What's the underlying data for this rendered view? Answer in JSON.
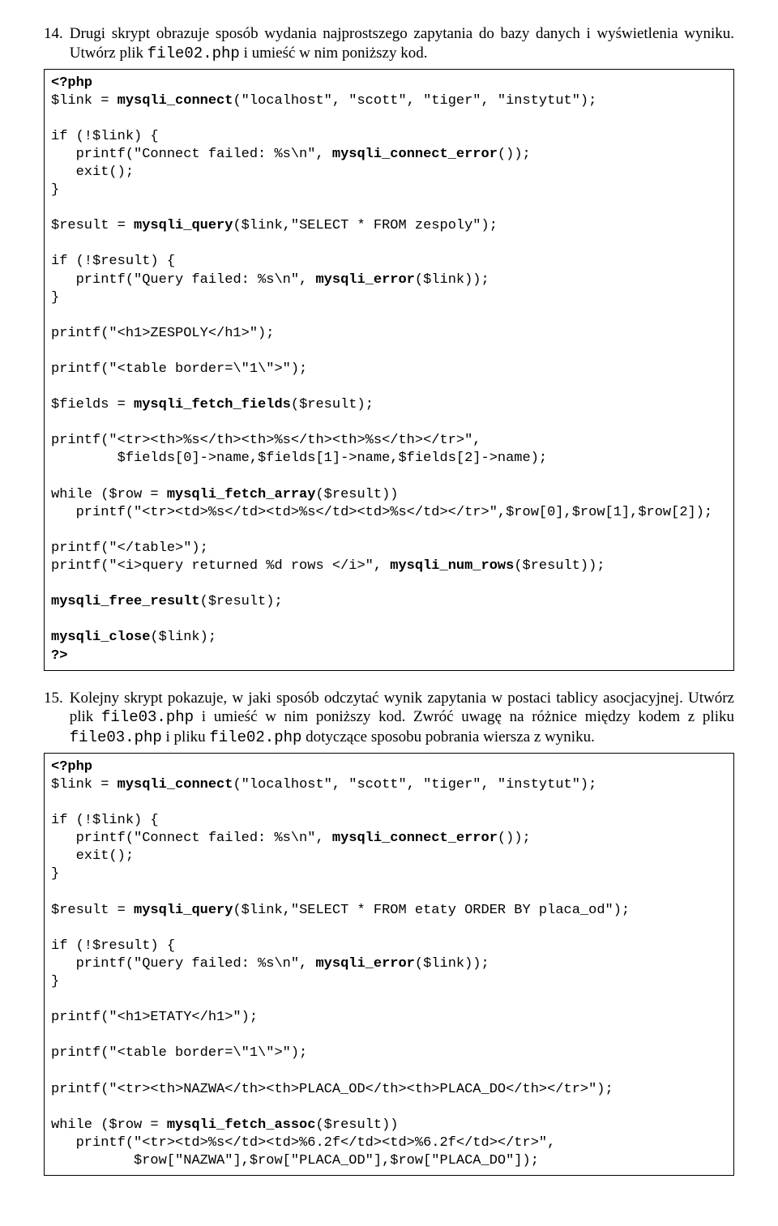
{
  "items": [
    {
      "num": "14.",
      "text_parts": [
        {
          "t": "Drugi skrypt obrazuje sposób wydania najprostszego zapytania do bazy danych i wyświetlenia wyniku. Utwórz plik "
        },
        {
          "t": "file02.php",
          "mono": true
        },
        {
          "t": " i umieść w nim poniższy kod."
        }
      ],
      "code": [
        {
          "segs": [
            {
              "t": "<?php",
              "b": true
            }
          ]
        },
        {
          "segs": [
            {
              "t": "$link = "
            },
            {
              "t": "mysqli_connect",
              "b": true
            },
            {
              "t": "(\"localhost\", \"scott\", \"tiger\", \"instytut\");"
            }
          ]
        },
        {
          "segs": [
            {
              "t": ""
            }
          ]
        },
        {
          "segs": [
            {
              "t": "if (!$link) {"
            }
          ]
        },
        {
          "segs": [
            {
              "t": "   printf(\"Connect failed: %s\\n\", "
            },
            {
              "t": "mysqli_connect_error",
              "b": true
            },
            {
              "t": "());"
            }
          ]
        },
        {
          "segs": [
            {
              "t": "   exit();"
            }
          ]
        },
        {
          "segs": [
            {
              "t": "}"
            }
          ]
        },
        {
          "segs": [
            {
              "t": ""
            }
          ]
        },
        {
          "segs": [
            {
              "t": "$result = "
            },
            {
              "t": "mysqli_query",
              "b": true
            },
            {
              "t": "($link,\"SELECT * FROM zespoly\");"
            }
          ]
        },
        {
          "segs": [
            {
              "t": ""
            }
          ]
        },
        {
          "segs": [
            {
              "t": "if (!$result) {"
            }
          ]
        },
        {
          "segs": [
            {
              "t": "   printf(\"Query failed: %s\\n\", "
            },
            {
              "t": "mysqli_error",
              "b": true
            },
            {
              "t": "($link));"
            }
          ]
        },
        {
          "segs": [
            {
              "t": "}"
            }
          ]
        },
        {
          "segs": [
            {
              "t": ""
            }
          ]
        },
        {
          "segs": [
            {
              "t": "printf(\"<h1>ZESPOLY</h1>\");"
            }
          ]
        },
        {
          "segs": [
            {
              "t": ""
            }
          ]
        },
        {
          "segs": [
            {
              "t": "printf(\"<table border=\\\"1\\\">\");"
            }
          ]
        },
        {
          "segs": [
            {
              "t": ""
            }
          ]
        },
        {
          "segs": [
            {
              "t": "$fields = "
            },
            {
              "t": "mysqli_fetch_fields",
              "b": true
            },
            {
              "t": "($result);"
            }
          ]
        },
        {
          "segs": [
            {
              "t": ""
            }
          ]
        },
        {
          "segs": [
            {
              "t": "printf(\"<tr><th>%s</th><th>%s</th><th>%s</th></tr>\","
            }
          ]
        },
        {
          "segs": [
            {
              "t": "        $fields[0]->name,$fields[1]->name,$fields[2]->name);"
            }
          ]
        },
        {
          "segs": [
            {
              "t": ""
            }
          ]
        },
        {
          "segs": [
            {
              "t": "while ($row = "
            },
            {
              "t": "mysqli_fetch_array",
              "b": true
            },
            {
              "t": "($result))"
            }
          ]
        },
        {
          "segs": [
            {
              "t": "   printf(\"<tr><td>%s</td><td>%s</td><td>%s</td></tr>\",$row[0],$row[1],$row[2]);"
            }
          ]
        },
        {
          "segs": [
            {
              "t": ""
            }
          ]
        },
        {
          "segs": [
            {
              "t": "printf(\"</table>\");"
            }
          ]
        },
        {
          "segs": [
            {
              "t": "printf(\"<i>query returned %d rows </i>\", "
            },
            {
              "t": "mysqli_num_rows",
              "b": true
            },
            {
              "t": "($result));"
            }
          ]
        },
        {
          "segs": [
            {
              "t": ""
            }
          ]
        },
        {
          "segs": [
            {
              "t": "mysqli_free_result",
              "b": true
            },
            {
              "t": "($result);"
            }
          ]
        },
        {
          "segs": [
            {
              "t": ""
            }
          ]
        },
        {
          "segs": [
            {
              "t": "mysqli_close",
              "b": true
            },
            {
              "t": "($link);"
            }
          ]
        },
        {
          "segs": [
            {
              "t": "?>",
              "b": true
            }
          ]
        }
      ]
    },
    {
      "num": "15.",
      "text_parts": [
        {
          "t": "Kolejny skrypt pokazuje, w jaki sposób odczytać wynik zapytania w postaci tablicy asocjacyjnej. Utwórz plik "
        },
        {
          "t": "file03.php",
          "mono": true
        },
        {
          "t": " i umieść w nim poniższy kod. Zwróć uwagę na różnice między kodem z pliku "
        },
        {
          "t": "file03.php",
          "mono": true
        },
        {
          "t": " i pliku "
        },
        {
          "t": "file02.php",
          "mono": true
        },
        {
          "t": " dotyczące sposobu pobrania wiersza z wyniku."
        }
      ],
      "code": [
        {
          "segs": [
            {
              "t": "<?php",
              "b": true
            }
          ]
        },
        {
          "segs": [
            {
              "t": "$link = "
            },
            {
              "t": "mysqli_connect",
              "b": true
            },
            {
              "t": "(\"localhost\", \"scott\", \"tiger\", \"instytut\");"
            }
          ]
        },
        {
          "segs": [
            {
              "t": ""
            }
          ]
        },
        {
          "segs": [
            {
              "t": "if (!$link) {"
            }
          ]
        },
        {
          "segs": [
            {
              "t": "   printf(\"Connect failed: %s\\n\", "
            },
            {
              "t": "mysqli_connect_error",
              "b": true
            },
            {
              "t": "());"
            }
          ]
        },
        {
          "segs": [
            {
              "t": "   exit();"
            }
          ]
        },
        {
          "segs": [
            {
              "t": "}"
            }
          ]
        },
        {
          "segs": [
            {
              "t": ""
            }
          ]
        },
        {
          "segs": [
            {
              "t": "$result = "
            },
            {
              "t": "mysqli_query",
              "b": true
            },
            {
              "t": "($link,\"SELECT * FROM etaty ORDER BY placa_od\");"
            }
          ]
        },
        {
          "segs": [
            {
              "t": ""
            }
          ]
        },
        {
          "segs": [
            {
              "t": "if (!$result) {"
            }
          ]
        },
        {
          "segs": [
            {
              "t": "   printf(\"Query failed: %s\\n\", "
            },
            {
              "t": "mysqli_error",
              "b": true
            },
            {
              "t": "($link));"
            }
          ]
        },
        {
          "segs": [
            {
              "t": "}"
            }
          ]
        },
        {
          "segs": [
            {
              "t": ""
            }
          ]
        },
        {
          "segs": [
            {
              "t": "printf(\"<h1>ETATY</h1>\");"
            }
          ]
        },
        {
          "segs": [
            {
              "t": ""
            }
          ]
        },
        {
          "segs": [
            {
              "t": "printf(\"<table border=\\\"1\\\">\");"
            }
          ]
        },
        {
          "segs": [
            {
              "t": ""
            }
          ]
        },
        {
          "segs": [
            {
              "t": "printf(\"<tr><th>NAZWA</th><th>PLACA_OD</th><th>PLACA_DO</th></tr>\");"
            }
          ]
        },
        {
          "segs": [
            {
              "t": ""
            }
          ]
        },
        {
          "segs": [
            {
              "t": "while ($row = "
            },
            {
              "t": "mysqli_fetch_assoc",
              "b": true
            },
            {
              "t": "($result))"
            }
          ]
        },
        {
          "segs": [
            {
              "t": "   printf(\"<tr><td>%s</td><td>%6.2f</td><td>%6.2f</td></tr>\","
            }
          ]
        },
        {
          "segs": [
            {
              "t": "          $row[\"NAZWA\"],$row[\"PLACA_OD\"],$row[\"PLACA_DO\"]);"
            }
          ]
        }
      ]
    }
  ]
}
